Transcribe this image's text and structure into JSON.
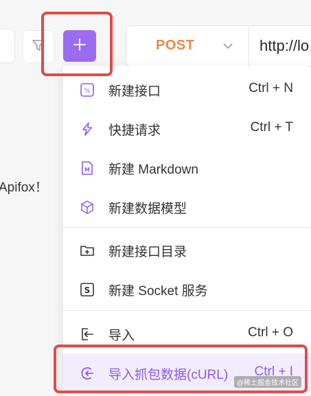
{
  "toolbar": {
    "add_label": "+",
    "method": "POST",
    "url": "http://lo"
  },
  "background_text": "Apifox！",
  "menu": {
    "items": [
      {
        "label": "新建接口",
        "shortcut": "Ctrl + N",
        "icon": "api-doc-icon"
      },
      {
        "label": "快捷请求",
        "shortcut": "Ctrl + T",
        "icon": "lightning-icon"
      },
      {
        "label": "新建 Markdown",
        "shortcut": "",
        "icon": "markdown-icon"
      },
      {
        "label": "新建数据模型",
        "shortcut": "",
        "icon": "cube-icon"
      },
      {
        "label": "新建接口目录",
        "shortcut": "",
        "icon": "folder-add-icon"
      },
      {
        "label": "新建 Socket 服务",
        "shortcut": "",
        "icon": "socket-icon"
      },
      {
        "label": "导入",
        "shortcut": "Ctrl + O",
        "icon": "import-icon"
      },
      {
        "label": "导入抓包数据(cURL)",
        "shortcut": "Ctrl + I",
        "icon": "curl-import-icon"
      }
    ]
  },
  "watermark": "@稀土掘金技术社区",
  "colors": {
    "accent": "#9b6cf0",
    "method": "#e8894a",
    "highlight": "#e64848",
    "active_bg": "#f2ecfd"
  }
}
